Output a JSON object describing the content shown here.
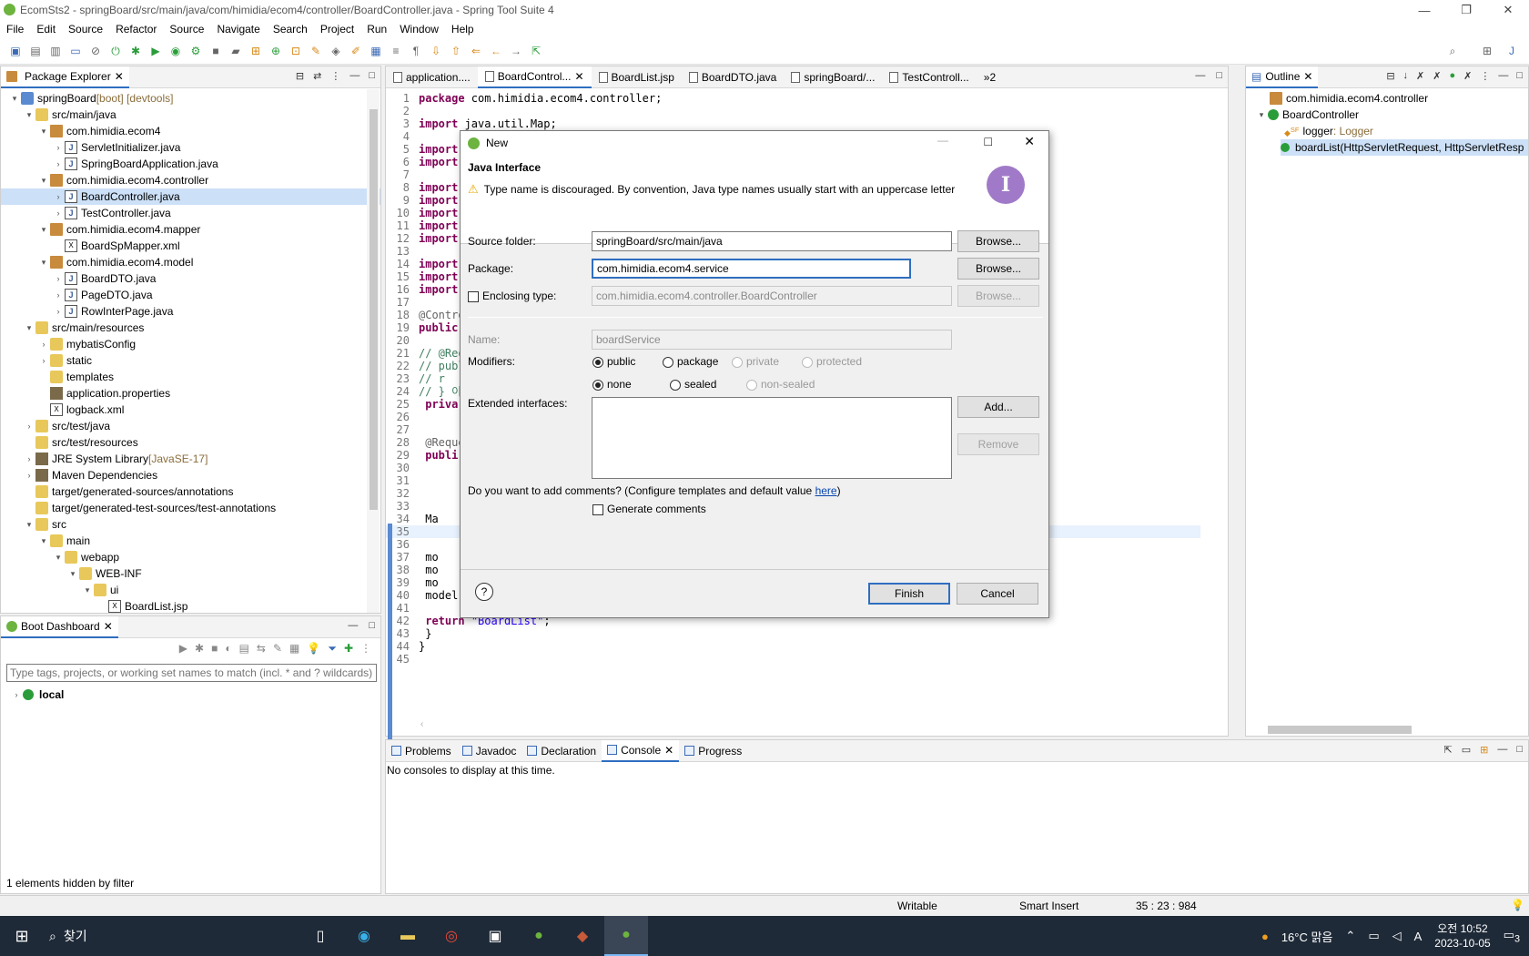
{
  "window": {
    "title": "EcomSts2 - springBoard/src/main/java/com/himidia/ecom4/controller/BoardController.java - Spring Tool Suite 4",
    "min": "—",
    "max": "❐",
    "close": "✕"
  },
  "menu": [
    "File",
    "Edit",
    "Source",
    "Refactor",
    "Source",
    "Navigate",
    "Search",
    "Project",
    "Run",
    "Window",
    "Help"
  ],
  "package_explorer": {
    "tab": "Package Explorer",
    "items": [
      {
        "depth": 0,
        "tw": "▾",
        "icon": "proj",
        "label": "springBoard",
        "suffix": " [boot] [devtools]"
      },
      {
        "depth": 1,
        "tw": "▾",
        "icon": "fold",
        "label": "src/main/java"
      },
      {
        "depth": 2,
        "tw": "▾",
        "icon": "pkg",
        "label": "com.himidia.ecom4"
      },
      {
        "depth": 3,
        "tw": "›",
        "icon": "java",
        "label": "ServletInitializer.java"
      },
      {
        "depth": 3,
        "tw": "›",
        "icon": "java",
        "label": "SpringBoardApplication.java"
      },
      {
        "depth": 2,
        "tw": "▾",
        "icon": "pkg",
        "label": "com.himidia.ecom4.controller"
      },
      {
        "depth": 3,
        "tw": "›",
        "icon": "java",
        "label": "BoardController.java",
        "sel": true
      },
      {
        "depth": 3,
        "tw": "›",
        "icon": "java",
        "label": "TestController.java"
      },
      {
        "depth": 2,
        "tw": "▾",
        "icon": "pkg",
        "label": "com.himidia.ecom4.mapper"
      },
      {
        "depth": 3,
        "tw": "",
        "icon": "xml",
        "label": "BoardSpMapper.xml"
      },
      {
        "depth": 2,
        "tw": "▾",
        "icon": "pkg",
        "label": "com.himidia.ecom4.model"
      },
      {
        "depth": 3,
        "tw": "›",
        "icon": "java",
        "label": "BoardDTO.java"
      },
      {
        "depth": 3,
        "tw": "›",
        "icon": "java",
        "label": "PageDTO.java"
      },
      {
        "depth": 3,
        "tw": "›",
        "icon": "java",
        "label": "RowInterPage.java"
      },
      {
        "depth": 1,
        "tw": "▾",
        "icon": "fold",
        "label": "src/main/resources"
      },
      {
        "depth": 2,
        "tw": "›",
        "icon": "fold",
        "label": "mybatisConfig"
      },
      {
        "depth": 2,
        "tw": "›",
        "icon": "fold",
        "label": "static"
      },
      {
        "depth": 2,
        "tw": "",
        "icon": "fold",
        "label": "templates"
      },
      {
        "depth": 2,
        "tw": "",
        "icon": "lib",
        "label": "application.properties"
      },
      {
        "depth": 2,
        "tw": "",
        "icon": "xml",
        "label": "logback.xml"
      },
      {
        "depth": 1,
        "tw": "›",
        "icon": "fold",
        "label": "src/test/java"
      },
      {
        "depth": 1,
        "tw": "",
        "icon": "fold",
        "label": "src/test/resources"
      },
      {
        "depth": 1,
        "tw": "›",
        "icon": "lib",
        "label": "JRE System Library",
        "suffix": " [JavaSE-17]"
      },
      {
        "depth": 1,
        "tw": "›",
        "icon": "lib",
        "label": "Maven Dependencies"
      },
      {
        "depth": 1,
        "tw": "",
        "icon": "fold",
        "label": "target/generated-sources/annotations"
      },
      {
        "depth": 1,
        "tw": "",
        "icon": "fold",
        "label": "target/generated-test-sources/test-annotations"
      },
      {
        "depth": 1,
        "tw": "▾",
        "icon": "fold",
        "label": "src"
      },
      {
        "depth": 2,
        "tw": "▾",
        "icon": "fold",
        "label": "main"
      },
      {
        "depth": 3,
        "tw": "▾",
        "icon": "fold",
        "label": "webapp"
      },
      {
        "depth": 4,
        "tw": "▾",
        "icon": "fold",
        "label": "WEB-INF"
      },
      {
        "depth": 5,
        "tw": "▾",
        "icon": "fold",
        "label": "ui"
      },
      {
        "depth": 6,
        "tw": "",
        "icon": "xml",
        "label": "BoardList.jsp"
      }
    ]
  },
  "boot_dashboard": {
    "tab": "Boot Dashboard",
    "filter_placeholder": "Type tags, projects, or working set names to match (incl. * and ? wildcards)",
    "local": "local",
    "hidden": "1 elements hidden by filter"
  },
  "editor": {
    "tabs": [
      "application....",
      "BoardControl...",
      "BoardList.jsp",
      "BoardDTO.java",
      "springBoard/...",
      "TestControll...",
      "»2"
    ],
    "active_tab": 1
  },
  "outline": {
    "tab": "Outline",
    "items": [
      {
        "label": "com.himidia.ecom4.controller"
      },
      {
        "label": "BoardController"
      },
      {
        "label": "logger",
        "type": " : Logger",
        "mod": "SF"
      },
      {
        "label": "boardList(HttpServletRequest, HttpServletResp"
      }
    ]
  },
  "bottom": {
    "tabs": [
      "Problems",
      "Javadoc",
      "Declaration",
      "Console",
      "Progress"
    ],
    "active": 3,
    "message": "No consoles to display at this time."
  },
  "status": {
    "writable": "Writable",
    "insert": "Smart Insert",
    "pos": "35 : 23 : 984"
  },
  "dialog": {
    "title": "New",
    "heading": "Java Interface",
    "warning": "Type name is discouraged. By convention, Java type names usually start with an uppercase letter",
    "source_folder_label": "Source folder:",
    "source_folder": "springBoard/src/main/java",
    "package_label": "Package:",
    "package": "com.himidia.ecom4.service",
    "enclosing_label": "Enclosing type:",
    "enclosing": "com.himidia.ecom4.controller.BoardController",
    "browse": "Browse...",
    "name_label": "Name:",
    "name": "boardService",
    "modifiers_label": "Modifiers:",
    "mod1": [
      "public",
      "package",
      "private",
      "protected"
    ],
    "mod2": [
      "none",
      "sealed",
      "non-sealed"
    ],
    "ext_label": "Extended interfaces:",
    "add": "Add...",
    "remove": "Remove",
    "comments_q": "Do you want to add comments? (Configure templates and default value ",
    "here": "here",
    "comments_end": ")",
    "generate": "Generate comments",
    "help": "?",
    "finish": "Finish",
    "cancel": "Cancel"
  },
  "taskbar": {
    "search": "찾기",
    "weather": "16°C 맑음",
    "time": "오전 10:52",
    "date": "2023-10-05",
    "notif": "3"
  }
}
